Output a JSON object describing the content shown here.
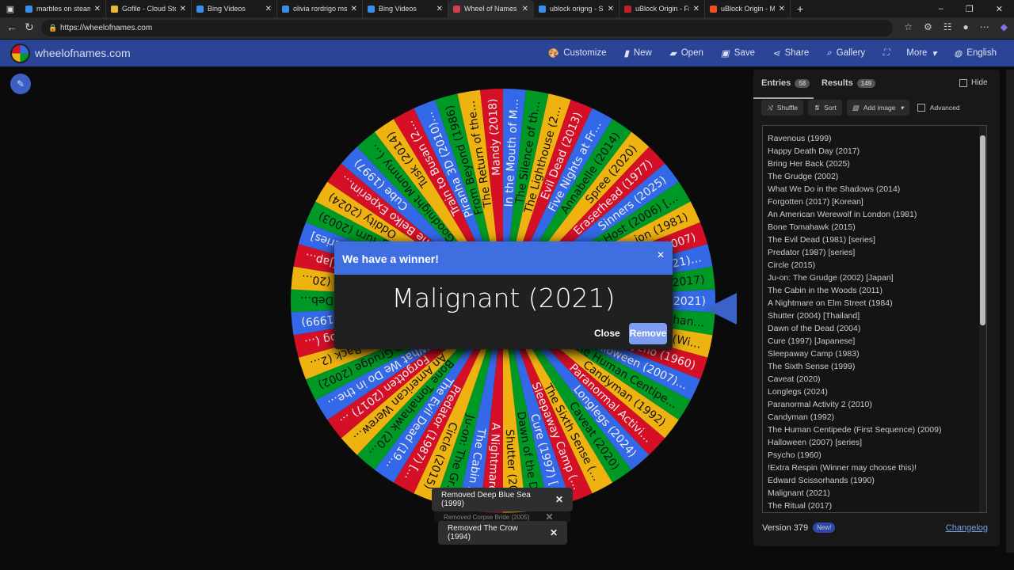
{
  "browser": {
    "tabs": [
      {
        "title": "marbles on steam - Se",
        "icon": "search-icon",
        "color": "#3a8ee6"
      },
      {
        "title": "Gofile - Cloud Storage",
        "icon": "folder-icon",
        "color": "#e8b83a"
      },
      {
        "title": "Bing Videos",
        "icon": "search-icon",
        "color": "#3a8ee6"
      },
      {
        "title": "olivia rordrigo msuic -",
        "icon": "search-icon",
        "color": "#3a8ee6"
      },
      {
        "title": "Bing Videos",
        "icon": "speaker-icon",
        "color": "#3a8ee6"
      },
      {
        "title": "Wheel of Names",
        "icon": "wheel-icon",
        "color": "#d04050",
        "active": true
      },
      {
        "title": "ublock origng - Search",
        "icon": "search-icon",
        "color": "#3a8ee6"
      },
      {
        "title": "uBlock Origin - Free, o",
        "icon": "ublock-icon",
        "color": "#c0202a"
      },
      {
        "title": "uBlock Origin - Micros",
        "icon": "microsoft-icon",
        "color": "#f25022"
      }
    ],
    "url": "https://wheelofnames.com"
  },
  "header": {
    "site": "wheelofnames.com",
    "menu": [
      "Customize",
      "New",
      "Open",
      "Save",
      "Share",
      "Gallery",
      "More",
      "English"
    ]
  },
  "wheel": {
    "pointer_color": "#3a62c8",
    "colors": [
      "#3369e8",
      "#009925",
      "#eeb211",
      "#d50f25"
    ],
    "labels": [
      "Malignant (2021)",
      "Edward Scissorhan…",
      "!Extra Respin (Wi…",
      "Psycho (1960)",
      "Halloween (2007)…",
      "The Human Centipe…",
      "Candyman (1992)",
      "Paranormal Activi…",
      "Longlegs (2024)",
      "Caveat (2020)",
      "The Sixth Sense (…",
      "Sleepaway Camp (…",
      "Cure (1997) […",
      "Dawn of the D…",
      "Shutter (20…",
      "A Nightmare…",
      "The Cabin i…",
      "Ju-on: The Gr…",
      "Circle (2015)",
      "Predator (1987) […",
      "The Evil Dead (19…",
      "Bone Tomahawk (20…",
      "An American Werew…",
      "Forgotten (2017) …",
      "What We Do in the…",
      "The Grudge (2002)",
      "Bring Her Back (2…",
      "…Dog (…",
      "…us (1999)",
      "…of Deb…",
      "…me (20…",
      "…[Jap…",
      "…series]",
      "…g Turn (2003)",
      "Oddity (2024)",
      "The Belko Experim…",
      "Cube (1997)",
      "Goodnight Mommy (…",
      "Tusk (2014)",
      "Train to Busan (2…",
      "Piranha 3D (2010)…",
      "From Beyond (1986)",
      "The Return of the…",
      "Mandy (2018)",
      "In the Mouth of M…",
      "The Silence of th…",
      "The Lighthouse (2…",
      "Evil Dead (2013)",
      "Five Nights at Fr…",
      "Annabelle (2014)",
      "Spree (2020)",
      "Eraserhead (1977)",
      "Sinners (2025)",
      "The Host (2006) […",
      "…ion (1981)",
      "…(2007)",
      "…(2021)…",
      "…al (2017)"
    ]
  },
  "dialog": {
    "title": "We have a winner!",
    "winner": "Malignant (2021)",
    "close": "Close",
    "remove": "Remove"
  },
  "toasts": [
    "Removed Deep Blue Sea (1999)",
    "Removed Corpse Bride (2005)",
    "Removed The Crow (1994)"
  ],
  "panel": {
    "tabs": [
      {
        "label": "Entries",
        "count": "58"
      },
      {
        "label": "Results",
        "count": "149"
      }
    ],
    "hide": "Hide",
    "tools": {
      "shuffle": "Shuffle",
      "sort": "Sort",
      "add_image": "Add image",
      "advanced": "Advanced"
    },
    "entries": [
      "Ravenous (1999)",
      "Happy Death Day (2017)",
      "Bring Her Back (2025)",
      "The Grudge (2002)",
      "What We Do in the Shadows (2014)",
      "Forgotten (2017) [Korean]",
      "An American Werewolf in London (1981)",
      "Bone Tomahawk (2015)",
      "The Evil Dead (1981) [series]",
      "Predator (1987) [series]",
      "Circle (2015)",
      "Ju-on: The Grudge (2002) [Japan]",
      "The Cabin in the Woods (2011)",
      "A Nightmare on Elm Street (1984)",
      "Shutter (2004) [Thailand]",
      "Dawn of the Dead (2004)",
      "Cure (1997) [Japanese]",
      "Sleepaway Camp (1983)",
      "The Sixth Sense (1999)",
      "Caveat (2020)",
      "Longlegs (2024)",
      "Paranormal Activity 2 (2010)",
      "Candyman (1992)",
      "The Human Centipede (First Sequence) (2009)",
      "Halloween (2007) [series]",
      "Psycho (1960)",
      "!Extra Respin (Winner may choose this)!",
      "Edward Scissorhands (1990)",
      "Malignant (2021)",
      "The Ritual (2017)"
    ],
    "version": "Version 379",
    "new": "New!",
    "changelog": "Changelog"
  }
}
